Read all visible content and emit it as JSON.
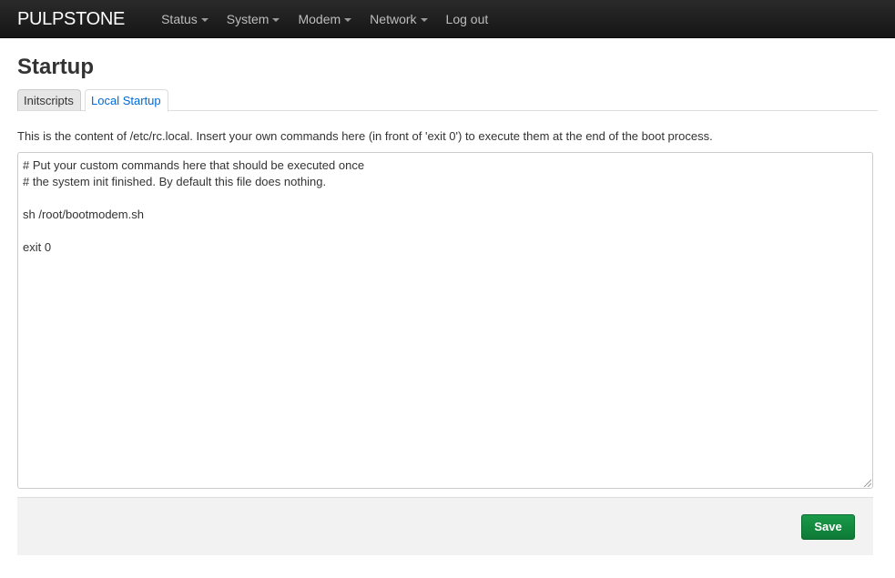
{
  "navbar": {
    "brand": "PULPSTONE",
    "items": [
      {
        "label": "Status",
        "has_dropdown": true
      },
      {
        "label": "System",
        "has_dropdown": true
      },
      {
        "label": "Modem",
        "has_dropdown": true
      },
      {
        "label": "Network",
        "has_dropdown": true
      },
      {
        "label": "Log out",
        "has_dropdown": false
      }
    ]
  },
  "page": {
    "title": "Startup",
    "tabs": [
      {
        "label": "Initscripts",
        "active": false
      },
      {
        "label": "Local Startup",
        "active": true
      }
    ],
    "description": "This is the content of /etc/rc.local. Insert your own commands here (in front of 'exit 0') to execute them at the end of the boot process.",
    "editor_lines": [
      "# Put your custom commands here that should be executed once",
      "# the system init finished. By default this file does nothing.",
      "",
      "sh /root/bootmodem.sh",
      "",
      "exit 0"
    ],
    "save_label": "Save"
  },
  "colors": {
    "navbar_bg": "#1b1b1b",
    "link": "#0069d6",
    "save_button": "#138b42",
    "footer_bg": "#f2f2f2"
  }
}
